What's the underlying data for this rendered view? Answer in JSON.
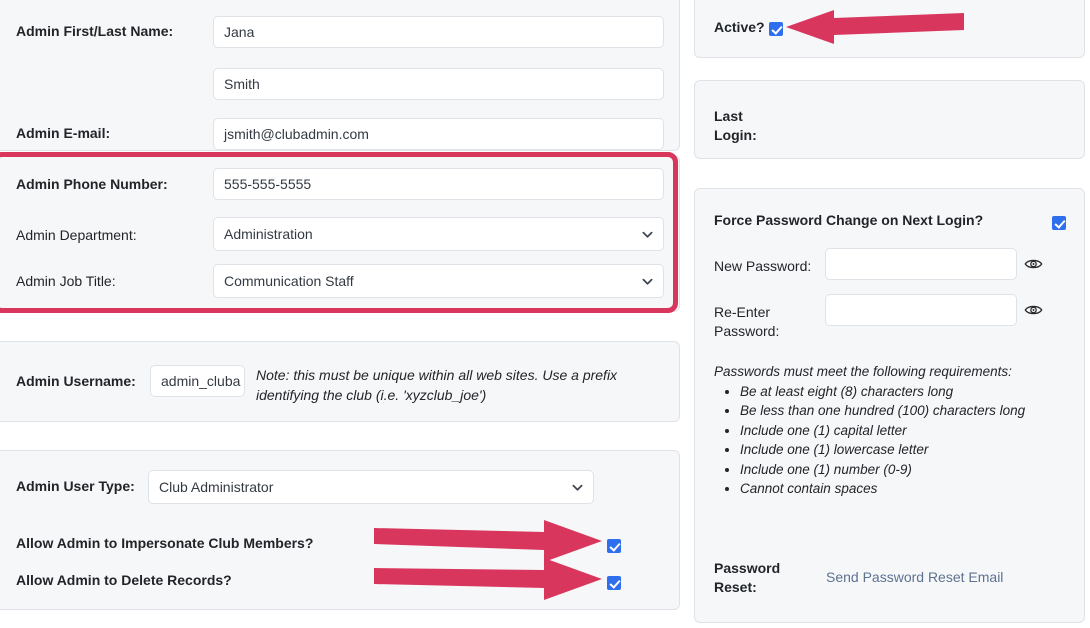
{
  "colors": {
    "accent_annotation": "#d9365e",
    "checkbox_blue": "#2f6fed",
    "panel_bg": "#f6f7f9",
    "panel_border": "#dfe3e8",
    "link": "#5d7291"
  },
  "left_column": {
    "identity_panel": {
      "name_label": "Admin First/Last Name:",
      "first_name_value": "Jana",
      "last_name_value": "Smith",
      "email_label": "Admin E-mail:",
      "email_value": "jsmith@clubadmin.com"
    },
    "contact_panel": {
      "highlighted": true,
      "phone_label": "Admin Phone Number:",
      "phone_value": "555-555-5555",
      "department_label": "Admin Department:",
      "department_value": "Administration",
      "job_title_label": "Admin Job Title:",
      "job_title_value": "Communication Staff"
    },
    "username_panel": {
      "username_label": "Admin Username:",
      "username_value": "admin_cluba",
      "note": "Note: this must be unique within all web sites. Use a prefix identifying the club (i.e. 'xyzclub_joe')"
    },
    "user_type_panel": {
      "user_type_label": "Admin User Type:",
      "user_type_value": "Club Administrator",
      "impersonate_label": "Allow Admin to Impersonate Club Members?",
      "impersonate_checked": true,
      "delete_records_label": "Allow Admin to Delete Records?",
      "delete_records_checked": true
    }
  },
  "right_column": {
    "active_panel": {
      "active_label": "Active?",
      "active_checked": true
    },
    "last_login_panel": {
      "last_login_label": "Last Login:",
      "last_login_value": ""
    },
    "password_panel": {
      "force_change_label": "Force Password Change on Next Login?",
      "force_change_checked": true,
      "new_password_label": "New Password:",
      "new_password_value": "",
      "reenter_password_label": "Re-Enter Password:",
      "reenter_password_value": "",
      "requirements_intro": "Passwords must meet the following requirements:",
      "requirements": [
        "Be at least eight (8) characters long",
        "Be less than one hundred (100) characters long",
        "Include one (1) capital letter",
        "Include one (1) lowercase letter",
        "Include one (1) number (0-9)",
        "Cannot contain spaces"
      ],
      "password_reset_label": "Password Reset:",
      "send_reset_link": "Send Password Reset Email"
    }
  },
  "annotations": {
    "active_arrow": "arrow-left-pointing-to-active-checkbox",
    "impersonate_arrow": "arrow-right-pointing-to-impersonate-checkbox",
    "delete_arrow": "arrow-right-pointing-to-delete-records-checkbox",
    "contact_highlight": "red-rounded-rectangle-highlight"
  }
}
